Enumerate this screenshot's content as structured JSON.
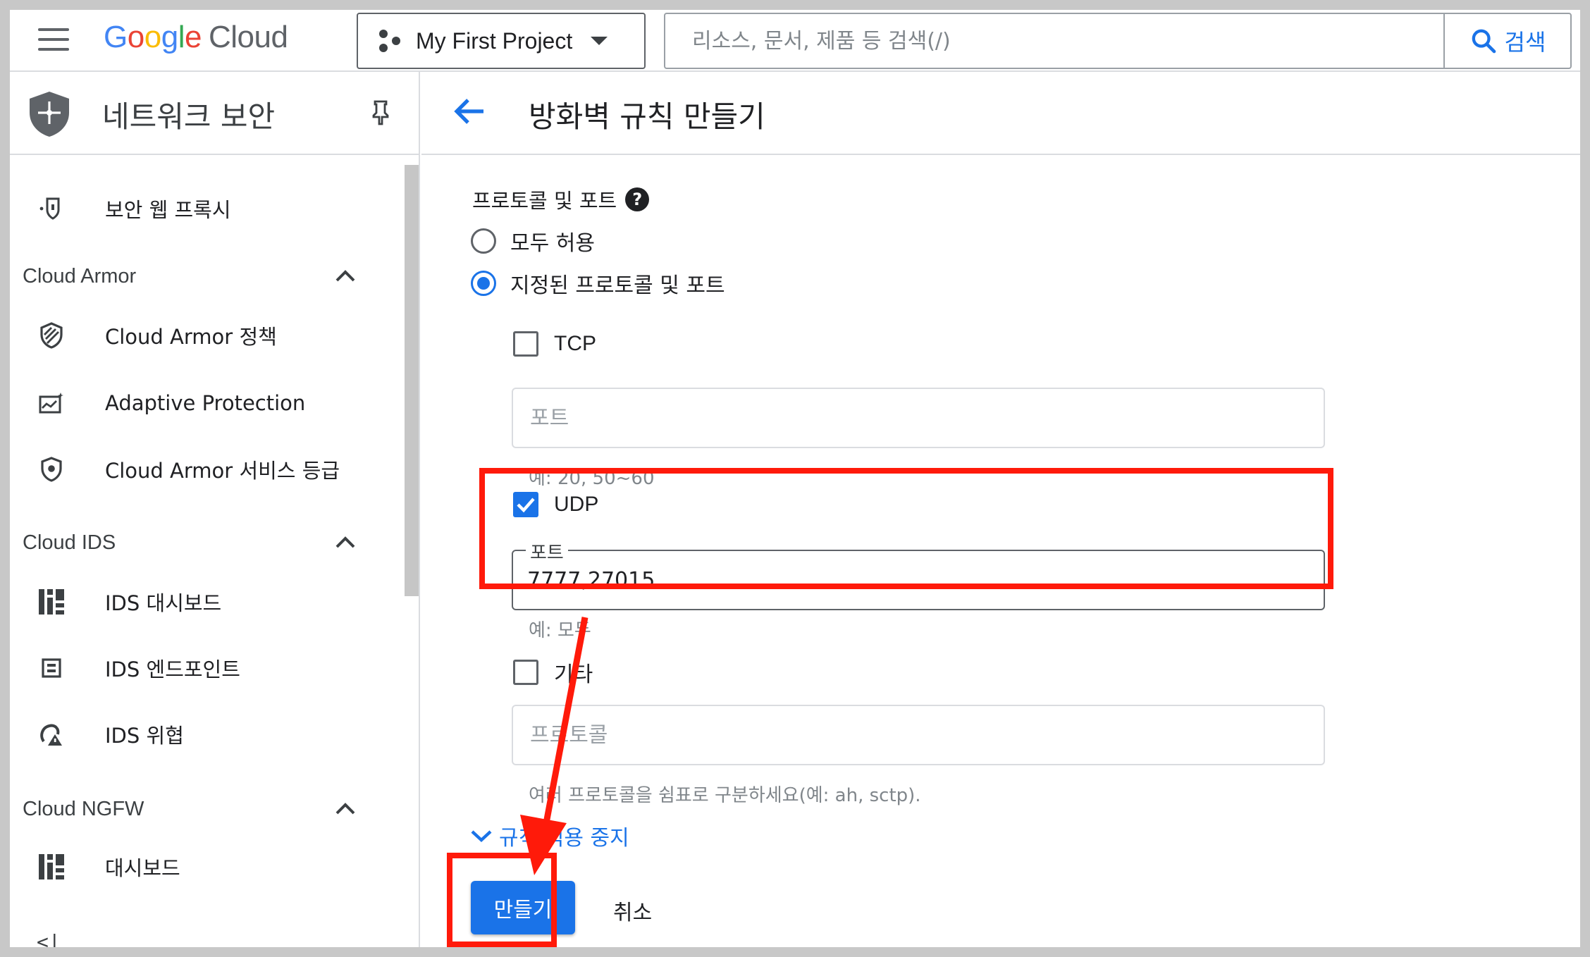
{
  "topbar": {
    "logo_parts": [
      "G",
      "o",
      "o",
      "g",
      "l",
      "e"
    ],
    "logo_suffix": "Cloud",
    "project_name": "My First Project",
    "search_placeholder": "리소스, 문서, 제품 등 검색(/)",
    "search_button": "검색"
  },
  "sidebar": {
    "title": "네트워크 보안",
    "items": {
      "secure_web_proxy": "보안 웹 프록시",
      "cloud_armor_section": "Cloud Armor",
      "cloud_armor_policy": "Cloud Armor 정책",
      "adaptive_protection": "Adaptive Protection",
      "cloud_armor_tier": "Cloud Armor 서비스 등급",
      "cloud_ids_section": "Cloud IDS",
      "ids_dashboard": "IDS 대시보드",
      "ids_endpoint": "IDS 엔드포인트",
      "ids_threat": "IDS 위협",
      "cloud_ngfw_section": "Cloud NGFW",
      "dashboard": "대시보드",
      "collapse": "<|"
    }
  },
  "main": {
    "title": "방화벽 규칙 만들기",
    "protocols_label": "프로토콜 및 포트",
    "radio_allow_all": "모두 허용",
    "radio_specified": "지정된 프로토콜 및 포트",
    "tcp": {
      "label": "TCP",
      "placeholder": "포트",
      "hint": "예: 20, 50~60",
      "checked": false
    },
    "udp": {
      "label": "UDP",
      "field_label": "포트",
      "value": "7777,27015",
      "hint": "예: 모두",
      "checked": true
    },
    "other": {
      "label": "기타",
      "placeholder": "프로토콜",
      "hint": "여러 프로토콜을 쉼표로 구분하세요(예: ah, sctp).",
      "checked": false
    },
    "expand_link": "규칙 적용 중지",
    "create_button": "만들기",
    "cancel_button": "취소"
  },
  "colors": {
    "accent": "#1a73e8",
    "annotation": "#ff1a0a"
  }
}
